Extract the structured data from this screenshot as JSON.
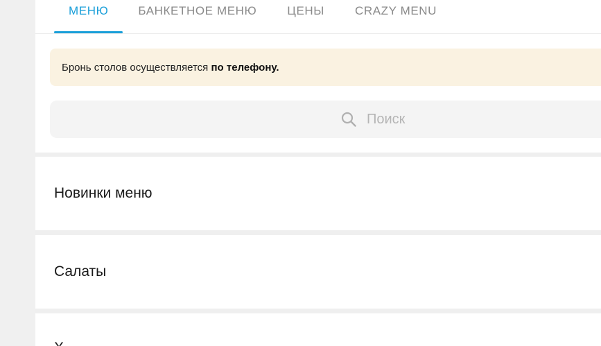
{
  "tabs": [
    {
      "label": "МЕНЮ",
      "active": true
    },
    {
      "label": "БАНКЕТНОЕ МЕНЮ",
      "active": false
    },
    {
      "label": "ЦЕНЫ",
      "active": false
    },
    {
      "label": "CRAZY MENU",
      "active": false
    }
  ],
  "notice": {
    "text": "Бронь столов осуществляется ",
    "bold": "по телефону."
  },
  "search": {
    "placeholder": "Поиск",
    "icon": "search-icon"
  },
  "sections": [
    {
      "title": "Новинки меню"
    },
    {
      "title": "Салаты"
    },
    {
      "title": "Х"
    }
  ],
  "colors": {
    "accent": "#1a9fd9",
    "notice_bg": "#faf2e1",
    "search_bg": "#f4f4f4"
  }
}
